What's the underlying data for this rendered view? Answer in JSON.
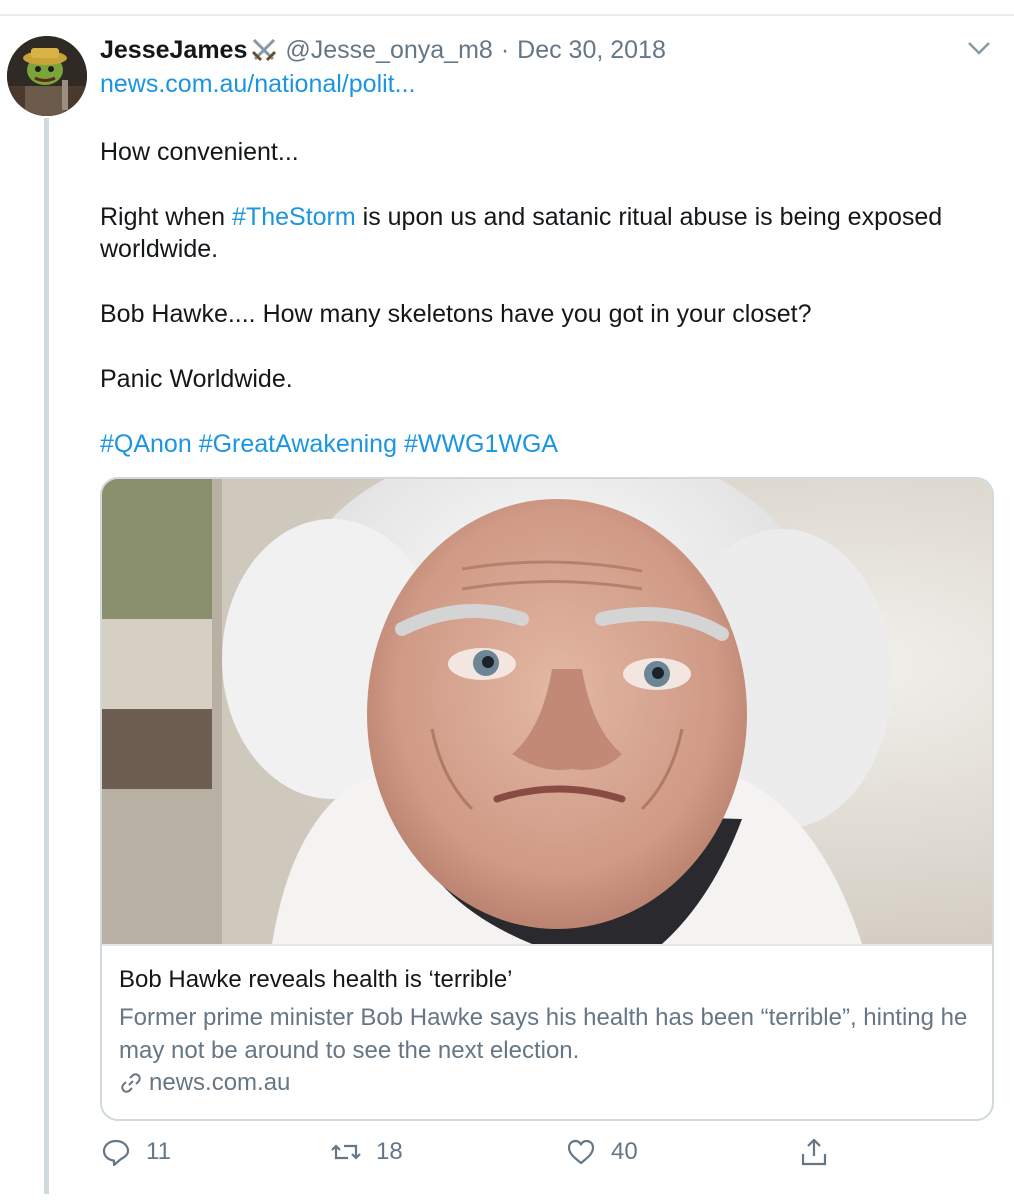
{
  "tweet": {
    "display_name": "JesseJames",
    "name_emoji_icon": "crossed-swords-icon",
    "handle": "@Jesse_onya_m8",
    "separator": "·",
    "date": "Dec 30, 2018",
    "link": "news.com.au/national/polit...",
    "text_lines": {
      "p1": "How convenient...",
      "p2_before": "Right when ",
      "p2_hashtag": "#TheStorm",
      "p2_after": " is upon us and satanic ritual abuse is being exposed worldwide.",
      "p3": "Bob Hawke.... How many skeletons have you got in your closet?",
      "p4": "Panic Worldwide."
    },
    "hashtags": [
      "#QAnon",
      "#GreatAwakening",
      "#WWG1WGA"
    ]
  },
  "card": {
    "image_icon": "portrait-photo",
    "title": "Bob Hawke reveals health is ‘terrible’",
    "description": "Former prime minister Bob Hawke says his health has been “terrible”, hinting he may not be around to see the next election.",
    "domain": "news.com.au"
  },
  "actions": {
    "reply_count": "11",
    "retweet_count": "18",
    "like_count": "40"
  },
  "colors": {
    "link": "#1b95e0",
    "secondary_text": "#657786",
    "border": "#cfd9de"
  }
}
